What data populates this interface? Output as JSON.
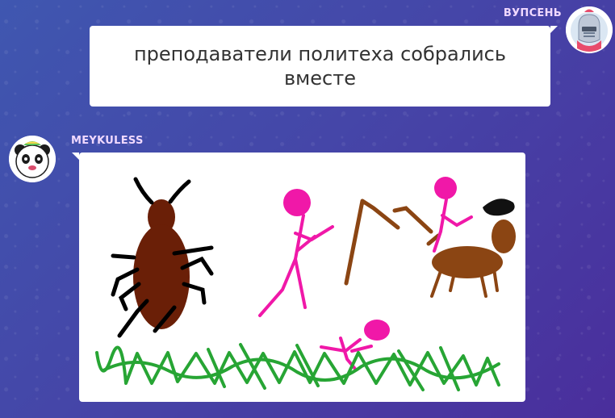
{
  "messages": [
    {
      "user": "ВУПСЕНЬ",
      "avatar": "knight-avatar",
      "text": "преподаватели политеха собрались вместе"
    },
    {
      "user": "MEYKULESS",
      "avatar": "panda-avatar",
      "drawing": "drawing"
    }
  ],
  "colors": {
    "background_start": "#3f57b0",
    "background_end": "#4a2e9c",
    "username": "#f0d9ff",
    "bubble": "#ffffff",
    "message_text": "#333333"
  }
}
